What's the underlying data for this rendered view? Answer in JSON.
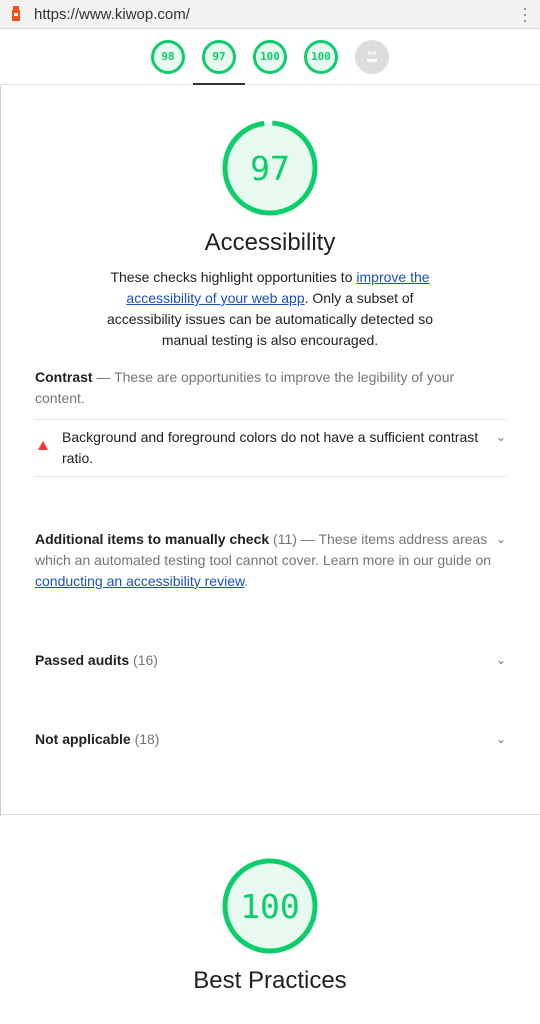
{
  "browser": {
    "url": "https://www.kiwop.com/",
    "menu_icon": "kebab-menu-icon",
    "favicon": "lighthouse-icon"
  },
  "gauges": [
    {
      "score": "98"
    },
    {
      "score": "97"
    },
    {
      "score": "100"
    },
    {
      "score": "100"
    },
    {
      "score": "PWA"
    }
  ],
  "accessibility": {
    "score": "97",
    "score_fraction": 0.97,
    "title": "Accessibility",
    "desc_1": "These checks highlight opportunities to ",
    "desc_link": "improve the accessibility of your web app",
    "desc_2": ". Only a subset of accessibility issues can be automatically detected so manual testing is also encouraged.",
    "contrast_title": "Contrast",
    "contrast_desc": " — These are opportunities to improve the legibility of your content.",
    "contrast_audit": "Background and foreground colors do not have a sufficient contrast ratio.",
    "manual_title": "Additional items to manually check",
    "manual_count": " (11)",
    "manual_desc": " — These items address areas which an automated testing tool cannot cover. Learn more in our guide on ",
    "manual_link": "conducting an accessibility review",
    "manual_end": ".",
    "passed_title": "Passed audits",
    "passed_count": " (16)",
    "na_title": "Not applicable",
    "na_count": " (18)"
  },
  "best_practices": {
    "score": "100",
    "score_fraction": 1.0,
    "title": "Best Practices"
  },
  "colors": {
    "pass": "#0cce6b",
    "fail": "#ff3333"
  }
}
